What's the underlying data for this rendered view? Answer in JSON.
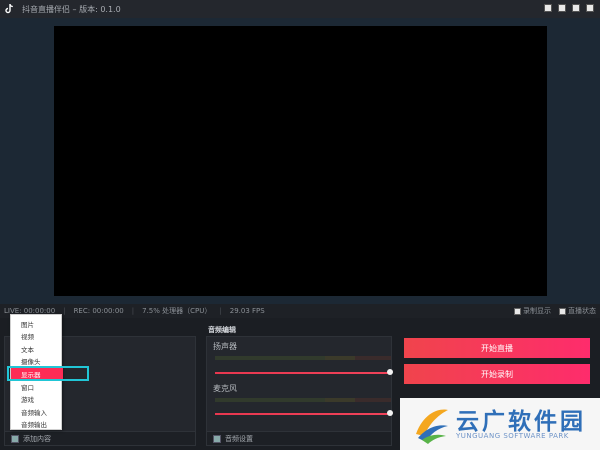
{
  "window": {
    "title": "抖音直播伴侣 – 版本: 0.1.0"
  },
  "status": {
    "live": "LIVE: 00:00:00",
    "rec": "REC: 00:00:00",
    "cpu": "7.5% 处理器（CPU）",
    "fps": "29.03 FPS",
    "toggle_record_display": "录制显示",
    "toggle_live_status": "直播状态"
  },
  "audio": {
    "title": "音频编辑",
    "speaker_label": "扬声器",
    "mic_label": "麦克风",
    "speaker_volume": 1.0,
    "mic_volume": 1.0,
    "settings_label": "音频设置"
  },
  "sources": {
    "add_label": "添加内容",
    "menu_items": [
      {
        "label": "图片"
      },
      {
        "label": "视频"
      },
      {
        "label": "文本"
      },
      {
        "label": "摄像头"
      },
      {
        "label": "显示器",
        "active": true
      },
      {
        "label": "窗口"
      },
      {
        "label": "游戏"
      },
      {
        "label": "音频输入"
      },
      {
        "label": "音频输出"
      }
    ]
  },
  "actions": {
    "start_live": "开始直播",
    "start_record": "开始录制"
  },
  "watermark": {
    "cn": "云广软件园",
    "en": "YUNGUANG SOFTWARE PARK"
  },
  "colors": {
    "accent": "#fe2c55",
    "highlight": "#21c6d6"
  }
}
